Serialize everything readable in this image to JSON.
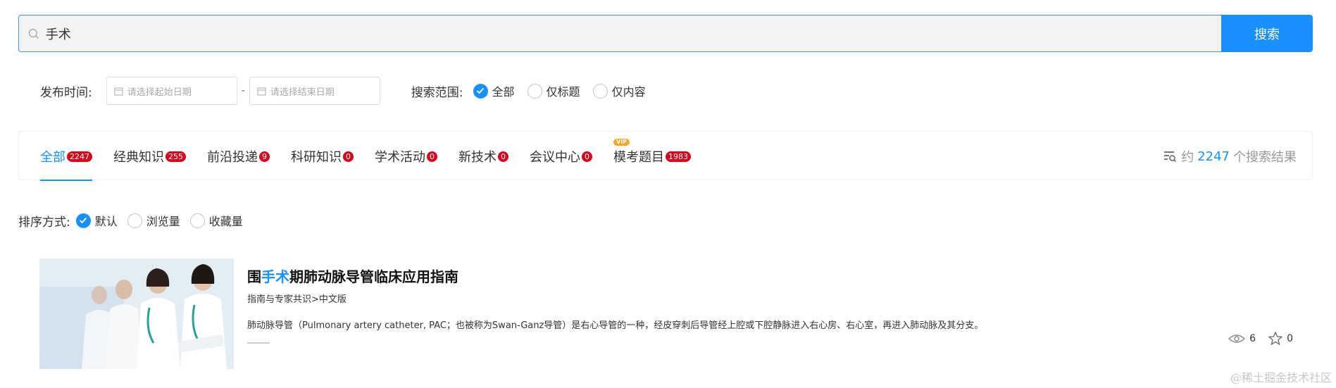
{
  "search": {
    "value": "手术",
    "button_label": "搜索"
  },
  "filters": {
    "date_label": "发布时间:",
    "start_placeholder": "请选择起始日期",
    "separator": "-",
    "end_placeholder": "请选择结束日期",
    "range_label": "搜索范围:",
    "range_options": [
      {
        "label": "全部",
        "checked": true
      },
      {
        "label": "仅标题",
        "checked": false
      },
      {
        "label": "仅内容",
        "checked": false
      }
    ]
  },
  "tabs": [
    {
      "label": "全部",
      "count": "2247",
      "active": true,
      "vip": false
    },
    {
      "label": "经典知识",
      "count": "255",
      "active": false,
      "vip": false
    },
    {
      "label": "前沿投递",
      "count": "9",
      "active": false,
      "vip": false
    },
    {
      "label": "科研知识",
      "count": "0",
      "active": false,
      "vip": false
    },
    {
      "label": "学术活动",
      "count": "0",
      "active": false,
      "vip": false
    },
    {
      "label": "新技术",
      "count": "0",
      "active": false,
      "vip": false
    },
    {
      "label": "会议中心",
      "count": "0",
      "active": false,
      "vip": false
    },
    {
      "label": "模考题目",
      "count": "1983",
      "active": false,
      "vip": true
    }
  ],
  "vip_label": "VIP",
  "result_count": {
    "prefix": "约",
    "number": "2247",
    "suffix": "个搜索结果"
  },
  "sort": {
    "label": "排序方式:",
    "options": [
      {
        "label": "默认",
        "checked": true
      },
      {
        "label": "浏览量",
        "checked": false
      },
      {
        "label": "收藏量",
        "checked": false
      }
    ]
  },
  "results": [
    {
      "title_pre": "围",
      "title_hl": "手术",
      "title_post": "期肺动脉导管临床应用指南",
      "category": "指南与专家共识>中文版",
      "description": "肺动脉导管（Pulmonary artery catheter, PAC；也被称为Swan-Ganz导管）是右心导管的一种，经皮穿刺后导管经上腔或下腔静脉进入右心房、右心室，再进入肺动脉及其分支。",
      "views": "6",
      "favorites": "0"
    }
  ],
  "watermark": "@稀土掘金技术社区",
  "colors": {
    "accent": "#1890ff",
    "badge": "#d9001b",
    "vip": "#f5a623"
  }
}
